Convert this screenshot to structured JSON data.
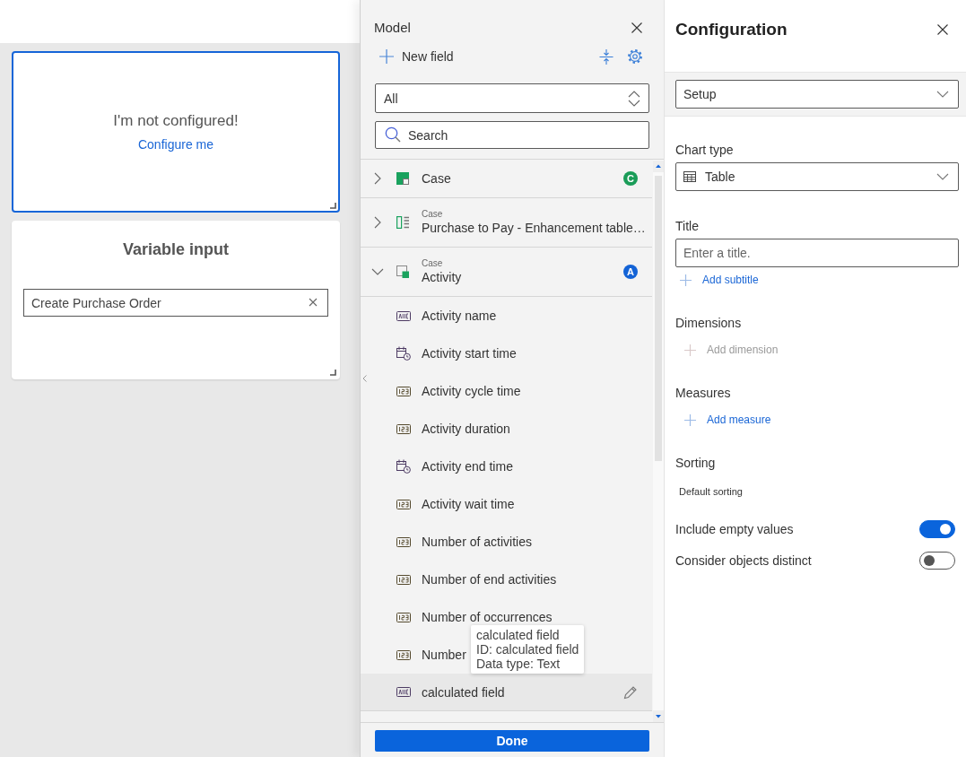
{
  "canvas": {
    "tiles": [
      {
        "kind": "placeholder",
        "selected": true,
        "message": "I'm not configured!",
        "link": "Configure me"
      },
      {
        "kind": "variable_input",
        "selected": false,
        "title": "Variable input",
        "value": "Create Purchase Order"
      }
    ]
  },
  "model": {
    "title": "Model",
    "new_field": "New field",
    "filter": {
      "value": "All"
    },
    "search": {
      "placeholder": "Search"
    },
    "tree": [
      {
        "kind": "case",
        "label": "Case",
        "expanded": false,
        "badge": "C",
        "color": "#1a9c58"
      },
      {
        "kind": "table",
        "sublabel": "Case",
        "label": "Purchase to Pay - Enhancement table…",
        "expanded": false
      },
      {
        "kind": "activity",
        "sublabel": "Case",
        "label": "Activity",
        "expanded": true,
        "badge": "A",
        "color": "#1363d6",
        "children": [
          {
            "kind": "text",
            "label": "Activity name",
            "highlighted": false
          },
          {
            "kind": "datetime",
            "label": "Activity start time",
            "highlighted": false
          },
          {
            "kind": "number",
            "label": "Activity cycle time",
            "highlighted": false
          },
          {
            "kind": "number",
            "label": "Activity duration",
            "highlighted": false
          },
          {
            "kind": "datetime",
            "label": "Activity end time",
            "highlighted": false
          },
          {
            "kind": "number",
            "label": "Activity wait time",
            "highlighted": false
          },
          {
            "kind": "number",
            "label": "Number of activities",
            "highlighted": false
          },
          {
            "kind": "number",
            "label": "Number of end activities",
            "highlighted": false
          },
          {
            "kind": "number",
            "label": "Number of occurrences",
            "highlighted": false
          },
          {
            "kind": "number",
            "label": "Number",
            "highlighted": false
          },
          {
            "kind": "text",
            "label": "calculated field",
            "highlighted": true
          }
        ]
      }
    ],
    "tooltip": {
      "lines": [
        "calculated field",
        "ID: calculated field",
        "Data type: Text"
      ]
    },
    "done": "Done"
  },
  "configuration": {
    "title": "Configuration",
    "view": "Setup",
    "sections": [
      {
        "kind": "select",
        "label": "Chart type",
        "value": "Table"
      },
      {
        "kind": "input",
        "label": "Title",
        "placeholder": "Enter a title.",
        "action": {
          "label": "Add subtitle",
          "disabled": false
        }
      },
      {
        "kind": "action",
        "label": "Dimensions",
        "action": {
          "label": "Add dimension",
          "disabled": true
        }
      },
      {
        "kind": "action",
        "label": "Measures",
        "action": {
          "label": "Add measure",
          "disabled": false
        }
      },
      {
        "kind": "text",
        "label": "Sorting",
        "value": "Default sorting"
      }
    ],
    "toggles": [
      {
        "label": "Include empty values",
        "on": true
      },
      {
        "label": "Consider objects distinct",
        "on": false
      }
    ]
  }
}
